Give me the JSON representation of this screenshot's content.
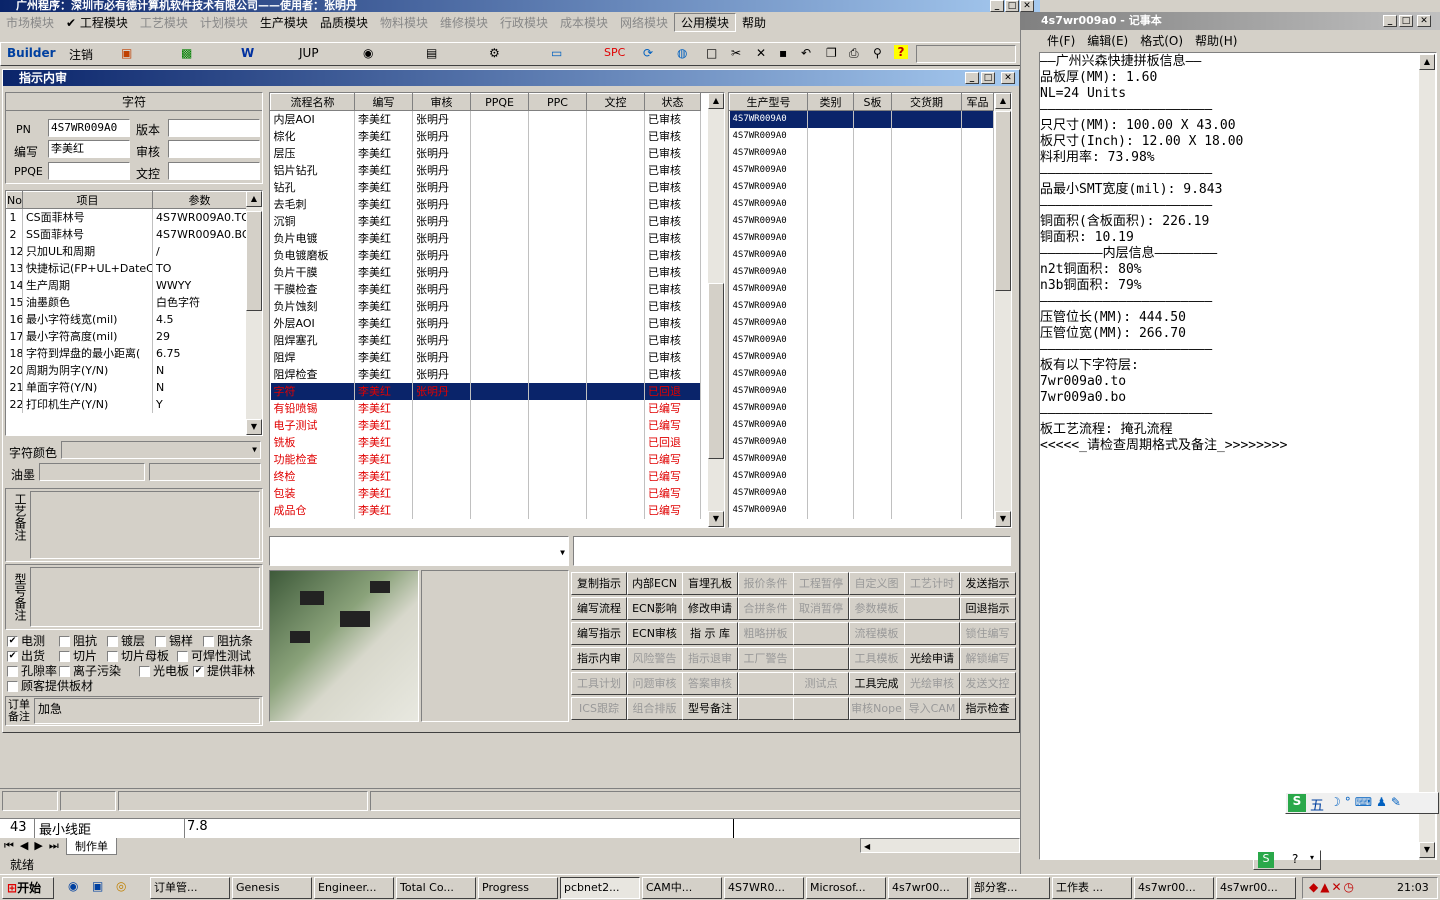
{
  "app": {
    "title": "广州程序：深圳市必有德计算机软件技术有限公司——使用者：张明丹"
  },
  "menu": [
    {
      "label": "市场模块",
      "disabled": true
    },
    {
      "label": "✔ 工程模块",
      "disabled": false
    },
    {
      "label": "工艺模块",
      "disabled": true
    },
    {
      "label": "计划模块",
      "disabled": true
    },
    {
      "label": "生产模块",
      "disabled": false
    },
    {
      "label": "品质模块",
      "disabled": false
    },
    {
      "label": "物料模块",
      "disabled": true
    },
    {
      "label": "维修模块",
      "disabled": true
    },
    {
      "label": "行政模块",
      "disabled": true
    },
    {
      "label": "成本模块",
      "disabled": true
    },
    {
      "label": "网络模块",
      "disabled": true
    },
    {
      "label": "公用模块",
      "disabled": false
    },
    {
      "label": "帮助",
      "disabled": false
    }
  ],
  "toolbar": {
    "builder": "Builder",
    "logout": "注销",
    "jup": "JUP",
    "spc": "SPC"
  },
  "child": {
    "title": "指示内审"
  },
  "char_panel": {
    "header": "字符",
    "pn_label": "PN",
    "pn_value": "4S7WR009A0",
    "version_label": "版本",
    "writer_label": "编写",
    "writer_value": "李美红",
    "review_label": "审核",
    "ppqe_label": "PPQE",
    "wenchk_label": "文控"
  },
  "params": {
    "headers": [
      "No",
      "项目",
      "参数"
    ],
    "rows": [
      [
        "1",
        "CS面菲林号",
        "4S7WR009A0.TO"
      ],
      [
        "2",
        "SS面菲林号",
        "4S7WR009A0.BO"
      ],
      [
        "12",
        "只加UL和周期",
        "/"
      ],
      [
        "13",
        "快捷标记(FP+UL+DateCo",
        "TO"
      ],
      [
        "14",
        "生产周期",
        "WWYY"
      ],
      [
        "15",
        "油墨颜色",
        "白色字符"
      ],
      [
        "16",
        "最小字符线宽(mil)",
        "4.5"
      ],
      [
        "17",
        "最小字符高度(mil)",
        "29"
      ],
      [
        "18",
        "字符到焊盘的最小距离(",
        "6.75"
      ],
      [
        "20",
        "周期为阴字(Y/N)",
        "N"
      ],
      [
        "21",
        "单面字符(Y/N)",
        "N"
      ],
      [
        "22",
        "打印机生产(Y/N)",
        "Y"
      ]
    ]
  },
  "left_lower": {
    "char_color": "字符颜色",
    "ink": "油墨",
    "process_note": "工艺备注",
    "model_note": "型号备注",
    "order_note_label": "订单备注",
    "order_note_value": "加急"
  },
  "checks": [
    {
      "label": "电测",
      "checked": true
    },
    {
      "label": "阻抗",
      "checked": false
    },
    {
      "label": "镀层",
      "checked": false
    },
    {
      "label": "锡样",
      "checked": false
    },
    {
      "label": "阻抗条",
      "checked": false
    },
    {
      "label": "出货",
      "checked": true
    },
    {
      "label": "切片",
      "checked": false
    },
    {
      "label": "切片母板",
      "checked": false
    },
    {
      "label": "可焊性测试",
      "checked": false
    },
    {
      "label": "孔隙率",
      "checked": false
    },
    {
      "label": "离子污染",
      "checked": false
    },
    {
      "label": "光电板",
      "checked": false
    },
    {
      "label": "提供菲林",
      "checked": true
    },
    {
      "label": "顾客提供板材",
      "checked": false
    }
  ],
  "flow": {
    "headers": [
      "流程名称",
      "编写",
      "审核",
      "PPQE",
      "PPC",
      "文控",
      "状态"
    ],
    "rows": [
      [
        "内层AOI",
        "李美红",
        "张明丹",
        "",
        "",
        "",
        "已审核"
      ],
      [
        "棕化",
        "李美红",
        "张明丹",
        "",
        "",
        "",
        "已审核"
      ],
      [
        "层压",
        "李美红",
        "张明丹",
        "",
        "",
        "",
        "已审核"
      ],
      [
        "铝片钻孔",
        "李美红",
        "张明丹",
        "",
        "",
        "",
        "已审核"
      ],
      [
        "钻孔",
        "李美红",
        "张明丹",
        "",
        "",
        "",
        "已审核"
      ],
      [
        "去毛刺",
        "李美红",
        "张明丹",
        "",
        "",
        "",
        "已审核"
      ],
      [
        "沉铜",
        "李美红",
        "张明丹",
        "",
        "",
        "",
        "已审核"
      ],
      [
        "负片电镀",
        "李美红",
        "张明丹",
        "",
        "",
        "",
        "已审核"
      ],
      [
        "负电镀磨板",
        "李美红",
        "张明丹",
        "",
        "",
        "",
        "已审核"
      ],
      [
        "负片干膜",
        "李美红",
        "张明丹",
        "",
        "",
        "",
        "已审核"
      ],
      [
        "干膜检查",
        "李美红",
        "张明丹",
        "",
        "",
        "",
        "已审核"
      ],
      [
        "负片蚀刻",
        "李美红",
        "张明丹",
        "",
        "",
        "",
        "已审核"
      ],
      [
        "外层AOI",
        "李美红",
        "张明丹",
        "",
        "",
        "",
        "已审核"
      ],
      [
        "阻焊塞孔",
        "李美红",
        "张明丹",
        "",
        "",
        "",
        "已审核"
      ],
      [
        "阻焊",
        "李美红",
        "张明丹",
        "",
        "",
        "",
        "已审核"
      ],
      [
        "阻焊检查",
        "李美红",
        "张明丹",
        "",
        "",
        "",
        "已审核"
      ],
      [
        "字符",
        "李美红",
        "张明丹",
        "",
        "",
        "",
        "已回退"
      ],
      [
        "有铅喷锡",
        "李美红",
        "",
        "",
        "",
        "",
        "已编写"
      ],
      [
        "电子测试",
        "李美红",
        "",
        "",
        "",
        "",
        "已编写"
      ],
      [
        "铣板",
        "李美红",
        "",
        "",
        "",
        "",
        "已回退"
      ],
      [
        "功能检查",
        "李美红",
        "",
        "",
        "",
        "",
        "已编写"
      ],
      [
        "终检",
        "李美红",
        "",
        "",
        "",
        "",
        "已编写"
      ],
      [
        "包装",
        "李美红",
        "",
        "",
        "",
        "",
        "已编写"
      ],
      [
        "成品仓",
        "李美红",
        "",
        "",
        "",
        "",
        "已编写"
      ]
    ]
  },
  "models": {
    "headers": [
      "生产型号",
      "类别",
      "S板",
      "交货期",
      "军品"
    ],
    "value": "4S7WR009A0",
    "count": 24
  },
  "buttons": [
    [
      "复制指示",
      "内部ECN",
      "盲埋孔板",
      "报价条件",
      "工程暂停",
      "自定义图",
      "工艺计时",
      "发送指示"
    ],
    [
      "编写流程",
      "ECN影响",
      "修改申请",
      "合拼条件",
      "取消暂停",
      "参数模板",
      "",
      "回退指示"
    ],
    [
      "编写指示",
      "ECN审核",
      "指 示 库",
      "粗略拼板",
      "",
      "流程模板",
      "",
      "锁住编写"
    ],
    [
      "指示内审",
      "风险警告",
      "指示退审",
      "工厂警告",
      "",
      "工具模板",
      "光绘申请",
      "解锁编写"
    ],
    [
      "工具计划",
      "问题审核",
      "答案审核",
      "",
      "测试点",
      "工具完成",
      "光绘审核",
      "发送文控"
    ],
    [
      "ICS跟踪",
      "组合排版",
      "型号备注",
      "",
      "",
      "审核Nope",
      "导入CAM",
      "指示检查"
    ]
  ],
  "buttons_enabled": [
    [
      true,
      true,
      true,
      false,
      false,
      false,
      false,
      true
    ],
    [
      true,
      true,
      true,
      false,
      false,
      false,
      false,
      true
    ],
    [
      true,
      true,
      true,
      false,
      false,
      false,
      false,
      false
    ],
    [
      true,
      false,
      false,
      false,
      false,
      false,
      true,
      false
    ],
    [
      false,
      false,
      false,
      false,
      false,
      true,
      false,
      false
    ],
    [
      false,
      false,
      true,
      false,
      false,
      false,
      false,
      true
    ]
  ],
  "sheet": {
    "row_no": "43",
    "row_label": "最小线距",
    "row_value": "7.8",
    "tab": "制作单",
    "status": "就绪"
  },
  "notepad": {
    "title": "4s7wr009a0 - 记事本",
    "menu": [
      "件(F)",
      "编辑(E)",
      "格式(O)",
      "帮助(H)"
    ],
    "lines": [
      "——广州兴森快捷拼板信息——",
      "品板厚(MM): 1.60",
      "NL=24 Units",
      "——————————————————————",
      "只尺寸(MM): 100.00 X 43.00",
      "板尺寸(Inch): 12.00 X 18.00",
      "料利用率: 73.98%",
      "——————————————————————",
      "品最小SMT宽度(mil): 9.843",
      "——————————————————————",
      "铜面积(含板面积): 226.19",
      "铜面积: 10.19",
      "————————内层信息————————",
      "n2t铜面积: 80%",
      "n3b铜面积: 79%",
      "——————————————————————",
      "压管位长(MM): 444.50",
      "压管位宽(MM): 266.70",
      "——————————————————————",
      "板有以下字符层:",
      "7wr009a0.to",
      "7wr009a0.bo",
      "——————————————————————",
      "板工艺流程: 掩孔流程",
      "<<<<<_请检查周期格式及备注_>>>>>>>>"
    ]
  },
  "ime": {
    "label": "五"
  },
  "taskbar": {
    "start": "开始",
    "clock": "21:03",
    "items": [
      "订单管...",
      "Genesis",
      "Engineer...",
      "Total Co...",
      "Progress",
      "pcbnet2...",
      "CAM中...",
      "4S7WR0...",
      "Microsof...",
      "4s7wr00...",
      "部分客...",
      "工作表 ...",
      "4s7wr00...",
      "4s7wr00..."
    ]
  }
}
